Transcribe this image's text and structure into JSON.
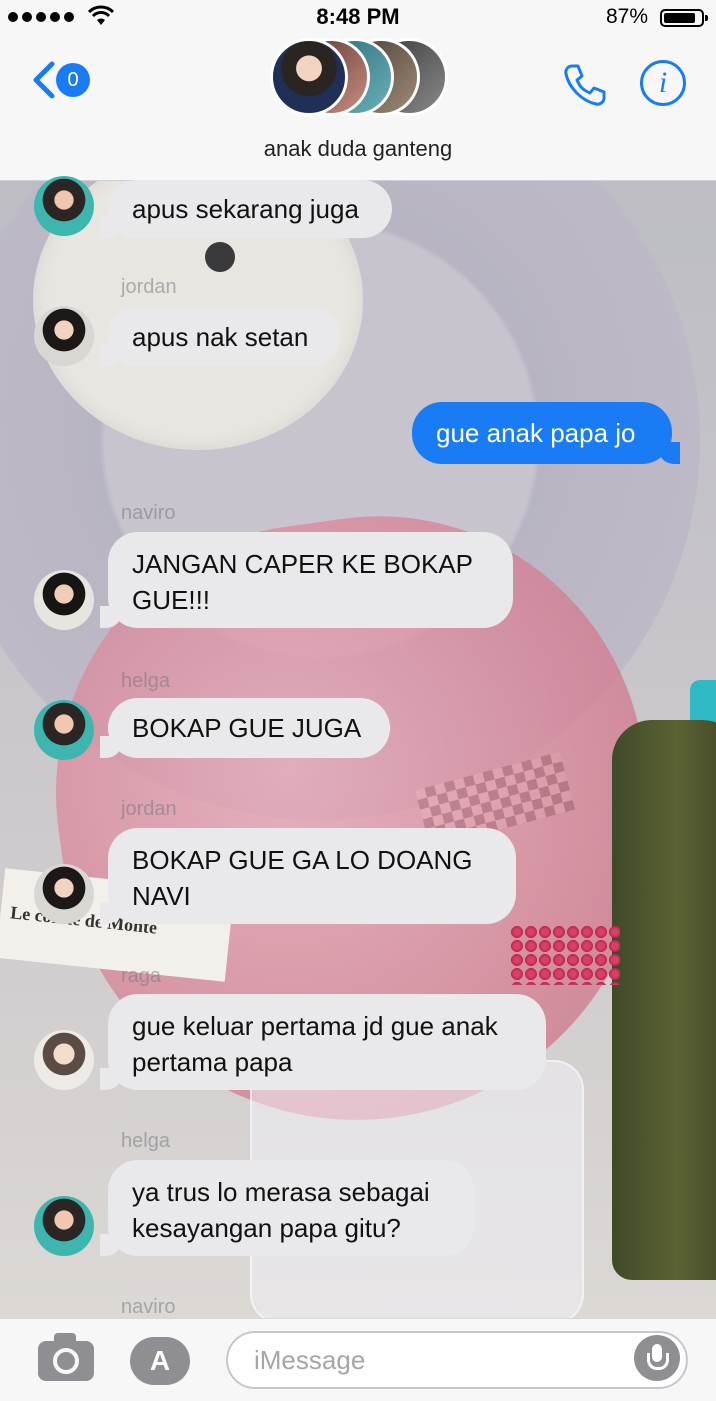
{
  "status_bar": {
    "time": "8:48 PM",
    "battery": "87%",
    "battery_level": 0.87
  },
  "header": {
    "back_count": "0",
    "group_name": "anak duda ganteng",
    "icons": [
      "back-chevron-icon",
      "phone-icon",
      "info-icon"
    ]
  },
  "messages": [
    {
      "sender": "",
      "text": "apus sekarang juga",
      "direction": "in"
    },
    {
      "sender": "jordan",
      "text": "apus nak setan",
      "direction": "in"
    },
    {
      "sender": "",
      "text": "gue anak papa jo",
      "direction": "out"
    },
    {
      "sender": "naviro",
      "text": "JANGAN CAPER KE BOKAP GUE!!!",
      "direction": "in"
    },
    {
      "sender": "helga",
      "text": "BOKAP GUE JUGA",
      "direction": "in"
    },
    {
      "sender": "jordan",
      "text": "BOKAP GUE GA LO DOANG NAVI",
      "direction": "in"
    },
    {
      "sender": "raga",
      "text": "gue keluar pertama jd gue anak pertama papa",
      "direction": "in"
    },
    {
      "sender": "helga",
      "text": "ya trus lo merasa sebagai kesayangan papa gitu?",
      "direction": "in"
    },
    {
      "sender": "naviro",
      "text": "",
      "direction": "in"
    }
  ],
  "wallpaper_text": "Le comte de Monte",
  "input_bar": {
    "placeholder": "iMessage",
    "icons": [
      "camera-icon",
      "app-store-icon",
      "microphone-icon"
    ]
  },
  "colors": {
    "accent": "#1a7cf5",
    "incoming_bubble": "#e9e9eb",
    "outgoing_bubble": "#1a7cf5"
  }
}
